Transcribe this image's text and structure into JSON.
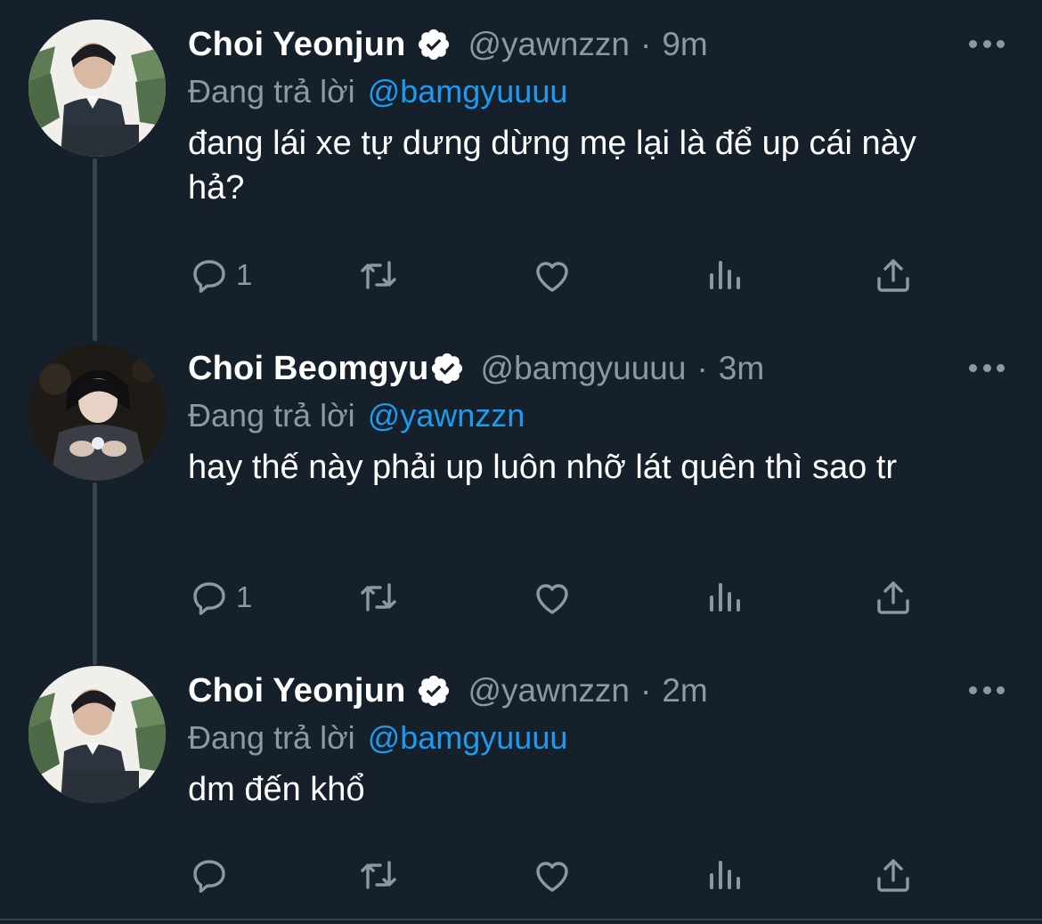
{
  "thread": {
    "tweets": [
      {
        "display_name": "Choi Yeonjun",
        "handle": "@yawnzzn",
        "separator": "·",
        "time": "9m",
        "reply_prefix": "Đang trả lời",
        "reply_to": "@bamgyuuuu",
        "text": "đang lái xe tự dưng dừng mẹ lại là để up cái này hả?",
        "reply_count": "1",
        "avatar": "photo-yeonjun"
      },
      {
        "display_name": "Choi Beomgyu",
        "handle": "@bamgyuuuu",
        "separator": "·",
        "time": "3m",
        "reply_prefix": "Đang trả lời",
        "reply_to": "@yawnzzn",
        "text": "hay thế này phải up luôn nhỡ lát quên thì sao tr",
        "reply_count": "1",
        "avatar": "photo-beomgyu"
      },
      {
        "display_name": "Choi Yeonjun",
        "handle": "@yawnzzn",
        "separator": "·",
        "time": "2m",
        "reply_prefix": "Đang trả lời",
        "reply_to": "@bamgyuuuu",
        "text": "dm đến khổ",
        "reply_count": "",
        "avatar": "photo-yeonjun"
      }
    ]
  },
  "icons": {
    "reply": "comment-icon",
    "retweet": "retweet-icon",
    "like": "heart-icon",
    "analytics": "analytics-icon",
    "share": "share-icon",
    "verified": "verified-badge-icon",
    "more": "more-icon"
  },
  "colors": {
    "background": "#15202b",
    "text": "#ffffff",
    "secondary": "#8b98a5",
    "link": "#1d9bf0",
    "thread_line": "#38444d"
  }
}
